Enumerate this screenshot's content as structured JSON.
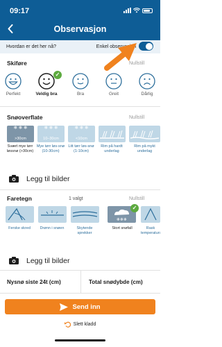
{
  "status": {
    "time": "09:17"
  },
  "header": {
    "title": "Observasjon"
  },
  "question": {
    "text": "Hvordan er det her nå?",
    "mode_label": "Enkel observasjon",
    "toggle_on": true
  },
  "skiing": {
    "title": "Skiføre",
    "reset": "Nullstill",
    "options": [
      {
        "label": "Perfekt",
        "icon": "big-smile-face-icon",
        "selected": false
      },
      {
        "label": "Veldig bra",
        "icon": "smile-face-icon",
        "selected": true
      },
      {
        "label": "Bra",
        "icon": "slight-smile-face-icon",
        "selected": false
      },
      {
        "label": "Greit",
        "icon": "neutral-face-icon",
        "selected": false
      },
      {
        "label": "Dårlig",
        "icon": "sad-face-icon",
        "selected": false
      }
    ]
  },
  "snow_surface": {
    "title": "Snøoverflate",
    "reset": "Nullstill",
    "options": [
      {
        "badge": ">30cm",
        "caption": "Svært mye tørr løssnø (>30cm)",
        "selected": true
      },
      {
        "badge": "10–30cm",
        "caption": "Mye tørr løs-snø (10-30cm)",
        "selected": false
      },
      {
        "badge": "<10cm",
        "caption": "Litt tørr løs-snø (1-10cm)",
        "selected": false
      },
      {
        "badge": "",
        "caption": "Rim på hardt underlag",
        "selected": false
      },
      {
        "badge": "",
        "caption": "Rim på mykt underlag",
        "selected": false
      }
    ]
  },
  "add_photos_1": {
    "label": "Legg til bilder"
  },
  "danger_signs": {
    "title": "Faretegn",
    "count": "1 valgt",
    "reset": "Nullstill",
    "options": [
      {
        "caption": "Ferske skred",
        "selected": false
      },
      {
        "caption": "Drønn i snøen",
        "selected": false
      },
      {
        "caption": "Skytende sprekker",
        "selected": false
      },
      {
        "caption": "Stort snøfall",
        "selected": true
      },
      {
        "caption": "Rask temperaturstig",
        "selected": false
      }
    ]
  },
  "add_photos_2": {
    "label": "Legg til bilder"
  },
  "fields": {
    "new_snow": "Nysnø siste 24t (cm)",
    "total_depth": "Total snødybde (cm)"
  },
  "actions": {
    "send": "Send inn",
    "delete_draft": "Slett kladd"
  },
  "colors": {
    "header": "#0e5d96",
    "accent": "#f0821e",
    "selected": "#5daa3f",
    "tile": "#bfd7e6"
  }
}
